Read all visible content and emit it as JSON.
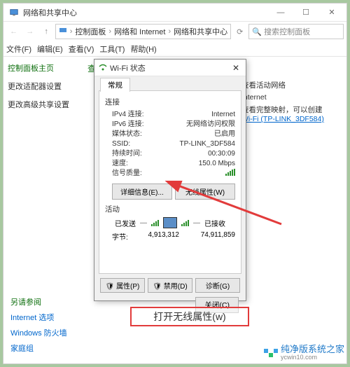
{
  "window": {
    "title": "网络和共享中心",
    "win_min": "—",
    "win_max": "☐",
    "win_close": "✕"
  },
  "breadcrumb": {
    "seg1": "控制面板",
    "seg2": "网络和 Internet",
    "seg3": "网络和共享中心",
    "refresh": "⟳",
    "search_placeholder": "搜索控制面板"
  },
  "menu": {
    "file": "文件(F)",
    "edit": "编辑(E)",
    "view": "查看(V)",
    "tools": "工具(T)",
    "help": "帮助(H)"
  },
  "sidebar": {
    "home": "控制面板主页",
    "adapter": "更改适配器设置",
    "advanced": "更改高级共享设置",
    "seealso": "另请参阅",
    "links": {
      "opt": "Internet 选项",
      "fw": "Windows 防火墙",
      "hg": "家庭组"
    }
  },
  "content": {
    "heading": "查看基本网络信息并设置连接",
    "active_label": "查看活动网络",
    "internet_word": "Internet",
    "desc": "查看完整映射，可以创建",
    "wifi_link": "Wi-Fi (TP-LINK_3DF584)"
  },
  "dialog": {
    "icon_title": "Wi-Fi 状态",
    "tab": "常规",
    "sec_conn": "连接",
    "rows": {
      "ipv4_k": "IPv4 连接:",
      "ipv4_v": "Internet",
      "ipv6_k": "IPv6 连接:",
      "ipv6_v": "无网络访问权限",
      "media_k": "媒体状态:",
      "media_v": "已启用",
      "ssid_k": "SSID:",
      "ssid_v": "TP-LINK_3DF584",
      "dur_k": "持续时间:",
      "dur_v": "00:30:09",
      "speed_k": "速度:",
      "speed_v": "150.0 Mbps",
      "signal_k": "信号质量:"
    },
    "btn_details": "详细信息(E)...",
    "btn_wprops": "无线属性(W)",
    "sec_act": "活动",
    "sent_label": "已发送",
    "recv_label": "已接收",
    "bytes_label": "字节:",
    "bytes_sent": "4,913,312",
    "bytes_recv": "74,911,859",
    "btn_props": "属性(P)",
    "btn_disable": "禁用(D)",
    "btn_diag": "诊断(G)",
    "btn_close": "关闭(C)"
  },
  "callout": {
    "text": "打开无线属性(w)"
  },
  "watermark": {
    "text": "纯净版系统之家",
    "url": "ycwin10.com"
  }
}
